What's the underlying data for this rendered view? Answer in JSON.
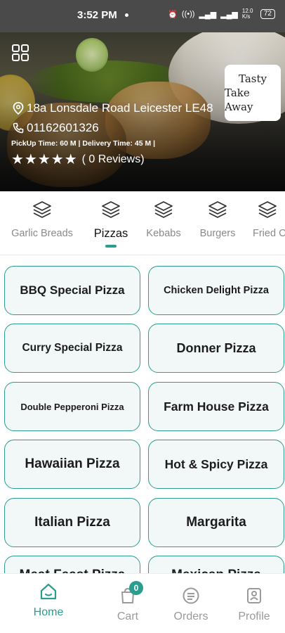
{
  "status_bar": {
    "time": "3:52 PM",
    "speed": "12.0 K/s",
    "battery": "72"
  },
  "restaurant": {
    "logo_line1": "Tasty",
    "logo_line2": "Take Away",
    "address": "18a Lonsdale Road Leicester LE48",
    "phone": "01162601326",
    "times": "PickUp Time: 60 M | Delivery Time: 45 M |",
    "stars": "★★★★★",
    "reviews": "( 0 Reviews)"
  },
  "categories": [
    {
      "label": "Garlic Breads"
    },
    {
      "label": "Pizzas",
      "active": true
    },
    {
      "label": "Kebabs"
    },
    {
      "label": "Burgers"
    },
    {
      "label": "Fried C"
    }
  ],
  "menu_items": [
    "BBQ Special Pizza",
    "Chicken Delight Pizza",
    "Curry Special Pizza",
    "Donner Pizza",
    "Double Pepperoni Pizza",
    "Farm House Pizza",
    "Hawaiian Pizza",
    "Hot & Spicy Pizza",
    "Italian Pizza",
    "Margarita",
    "Meat Feast Pizza",
    "Mexican Pizza"
  ],
  "bottom_nav": {
    "home": "Home",
    "cart": "Cart",
    "cart_count": "0",
    "orders": "Orders",
    "profile": "Profile"
  },
  "colors": {
    "accent": "#2a9d8f",
    "card_bg": "#f1f8f7"
  }
}
